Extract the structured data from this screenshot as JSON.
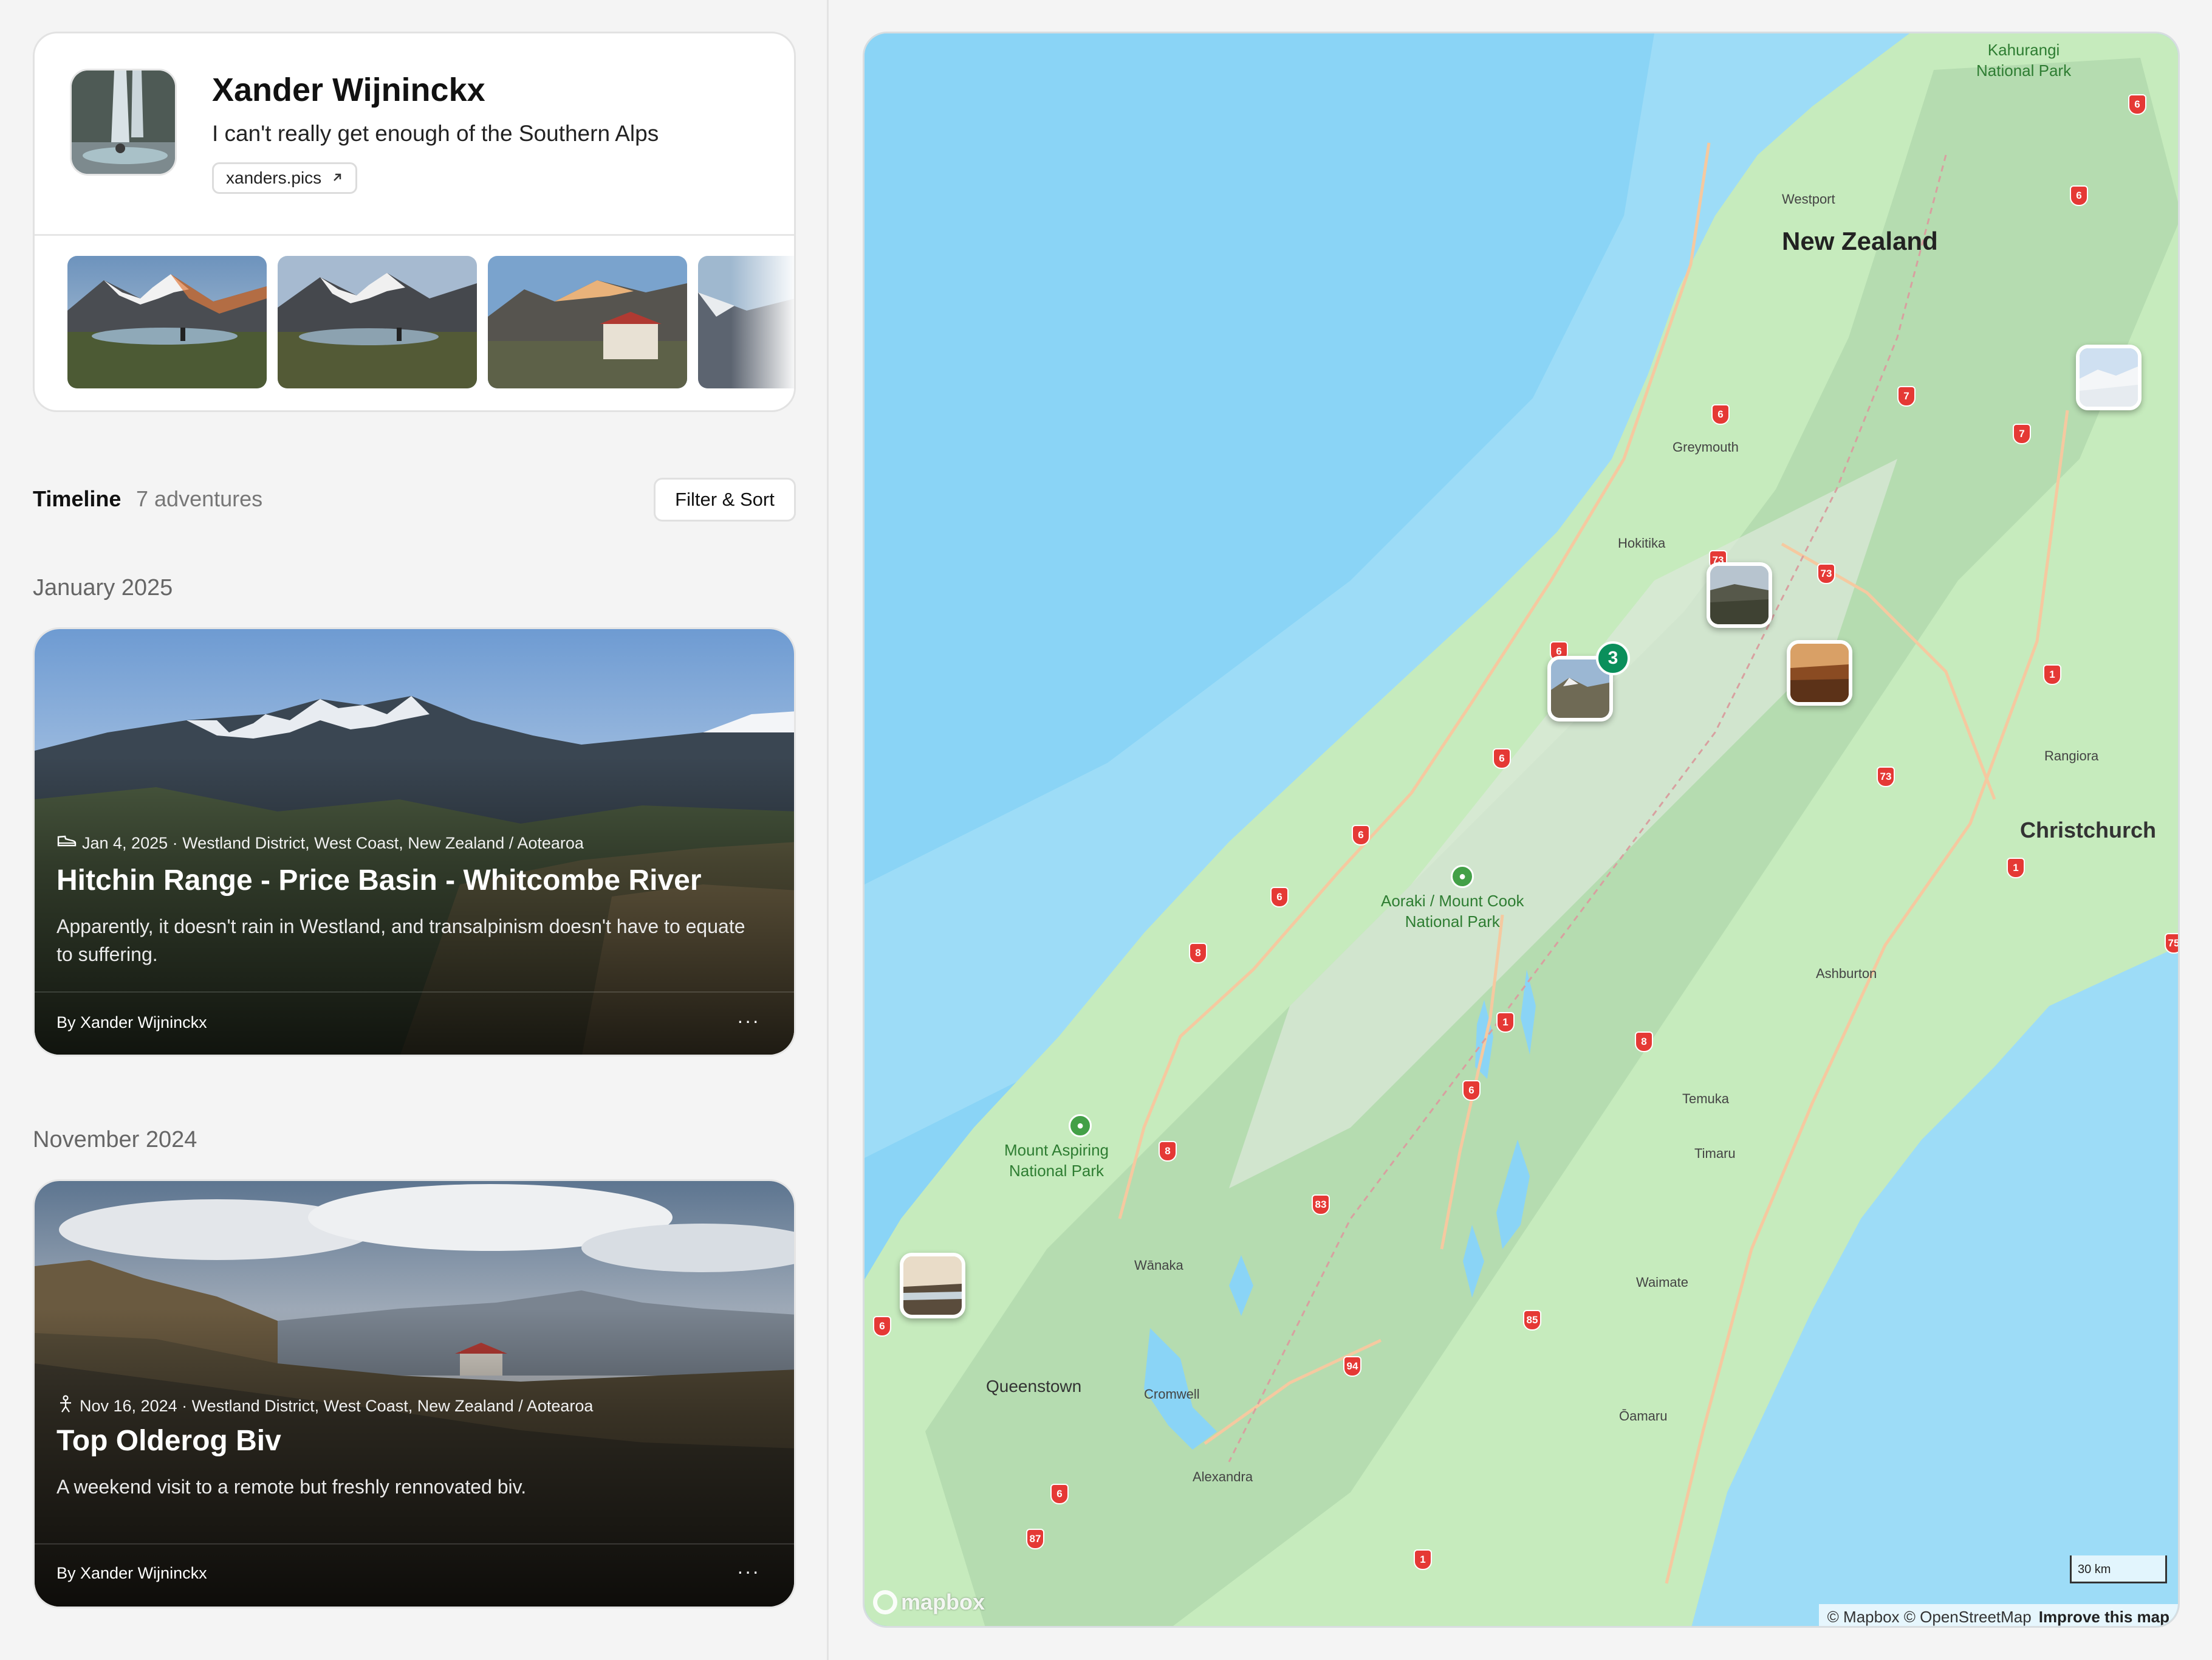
{
  "profile": {
    "name": "Xander Wijninckx",
    "bio": "I can't really get enough of the Southern Alps",
    "link_label": "xanders.pics",
    "link_icon": "arrow-up-right-icon"
  },
  "timeline": {
    "title": "Timeline",
    "count": "7 adventures",
    "filter_label": "Filter & Sort"
  },
  "groups": [
    {
      "month": "January 2025",
      "adventure": {
        "icon": "shoe-icon",
        "meta": "Jan 4, 2025 · Westland District, West Coast, New Zealand / Aotearoa",
        "title": "Hitchin Range - Price Basin - Whitcombe River",
        "description": "Apparently, it doesn't rain in Westland, and transalpinism doesn't have to equate to suffering.",
        "author": "By Xander Wijninckx",
        "more": "···"
      }
    },
    {
      "month": "November 2024",
      "adventure": {
        "icon": "hiker-icon",
        "meta": "Nov 16, 2024 · Westland District, West Coast, New Zealand / Aotearoa",
        "title": "Top Olderog Biv",
        "description": "A weekend visit to a remote but freshly rennovated biv.",
        "author": "By Xander Wijninckx",
        "more": "···"
      }
    }
  ],
  "map": {
    "country_label": "New Zealand",
    "cities": {
      "christchurch": "Christchurch",
      "queenstown": "Queenstown"
    },
    "towns": {
      "westport": "Westport",
      "greymouth": "Greymouth",
      "hokitika": "Hokitika",
      "rangiora": "Rangiora",
      "ashburton": "Ashburton",
      "temuka": "Temuka",
      "timaru": "Timaru",
      "waimate": "Waimate",
      "oamaru": "Ōamaru",
      "wanaka": "Wānaka",
      "cromwell": "Cromwell",
      "alexandra": "Alexandra"
    },
    "parks": {
      "kahurangi": "Kahurangi\nNational Park",
      "aoraki": "Aoraki / Mount Cook\nNational Park",
      "aspiring": "Mount Aspiring\nNational Park"
    },
    "highway_shields": [
      "6",
      "6",
      "7",
      "7",
      "6",
      "73",
      "73",
      "1",
      "73",
      "6",
      "6",
      "6",
      "6",
      "1",
      "75",
      "8",
      "1",
      "8",
      "6",
      "8",
      "83",
      "85",
      "94",
      "6",
      "6",
      "87",
      "1"
    ],
    "cluster_count": "3",
    "logo_text": "mapbox",
    "attribution": "© Mapbox © OpenStreetMap",
    "improve_link": "Improve this map",
    "scale_label": "30 km"
  },
  "colors": {
    "water": "#8ad4f6",
    "land": "#c9ecc0",
    "cluster_badge": "#0a8f5b",
    "highway_shield": "#e53935",
    "park": "#43a047"
  }
}
